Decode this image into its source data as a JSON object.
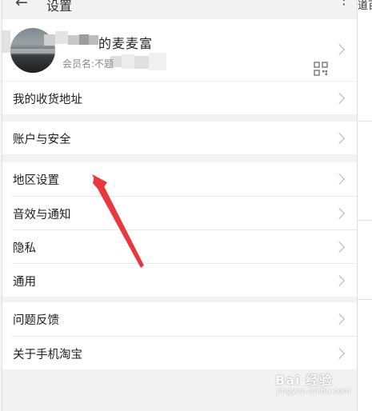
{
  "header": {
    "back_icon": "back-arrow-icon",
    "title": "设置",
    "more_icon": "more-vertical-icon"
  },
  "profile": {
    "nickname": "的麦麦富",
    "member_label": "会员名:不题",
    "qr_icon": "qr-code-icon"
  },
  "sections": [
    {
      "items": [
        {
          "label": "我的收货地址"
        }
      ]
    },
    {
      "items": [
        {
          "label": "账户与安全"
        }
      ]
    },
    {
      "items": [
        {
          "label": "地区设置"
        },
        {
          "label": "音效与通知"
        },
        {
          "label": "隐私"
        },
        {
          "label": "通用"
        }
      ]
    },
    {
      "items": [
        {
          "label": "问题反馈"
        },
        {
          "label": "关于手机淘宝"
        }
      ]
    }
  ],
  "background": {
    "right_text": "道百"
  },
  "watermark": {
    "text": "Bai 经验",
    "url": "jingyan.baidu.com"
  },
  "colors": {
    "annotation_arrow": "#e8383d",
    "divider": "#e8e8e8",
    "page_bg": "#f2f2f2"
  }
}
